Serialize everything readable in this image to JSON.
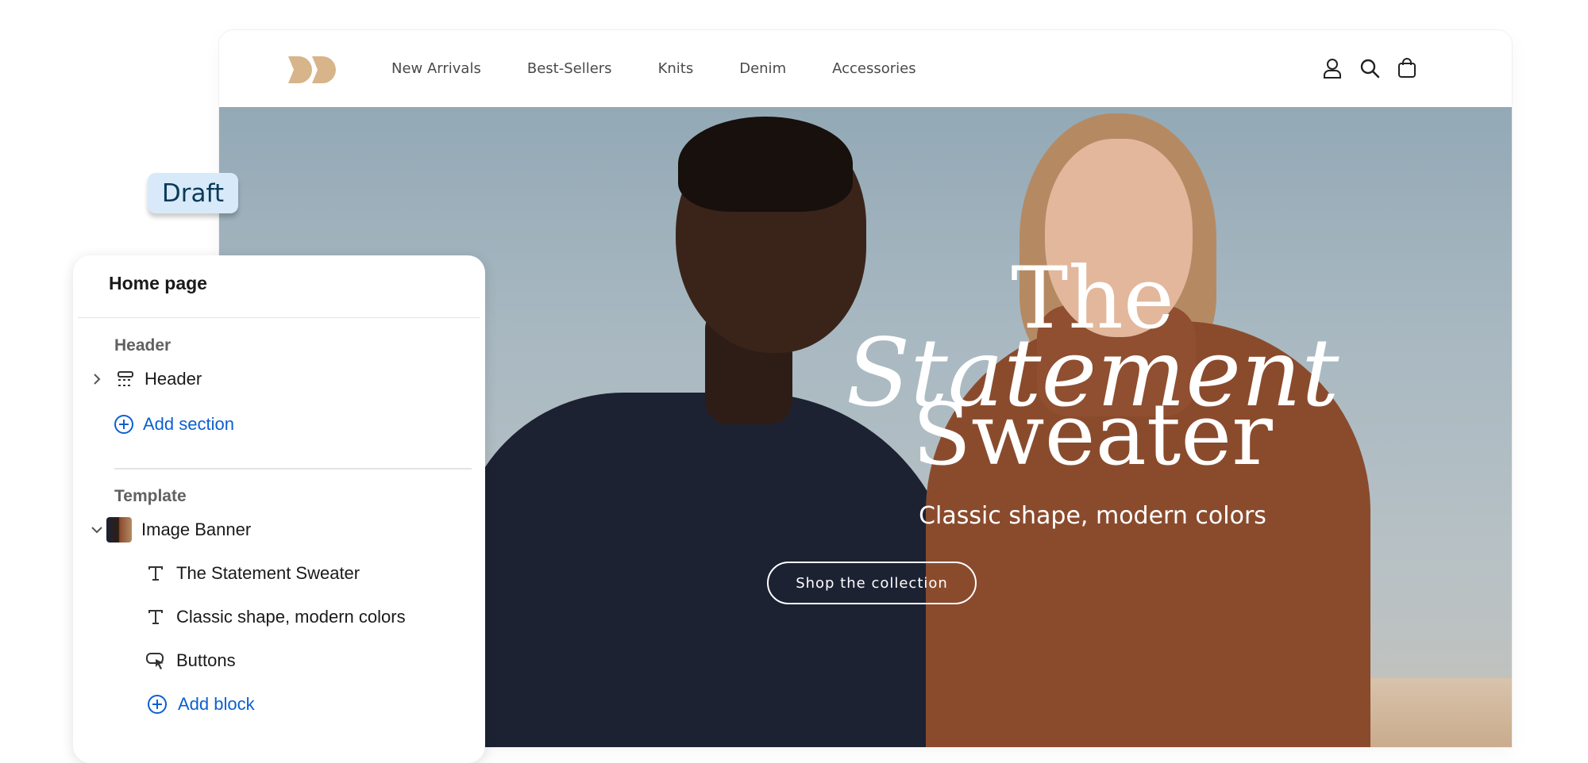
{
  "store": {
    "logo": "DD",
    "nav": [
      "New Arrivals",
      "Best-Sellers",
      "Knits",
      "Denim",
      "Accessories"
    ],
    "icons": [
      "account-icon",
      "search-icon",
      "cart-icon"
    ]
  },
  "hero": {
    "title_line1": "The",
    "title_line2": "Statement",
    "title_line3": "Sweater",
    "subtitle": "Classic shape, modern colors",
    "button": "Shop the collection"
  },
  "badge": {
    "label": "Draft"
  },
  "panel": {
    "title": "Home page",
    "header_group": "Header",
    "header_item": "Header",
    "add_section": "Add section",
    "template_group": "Template",
    "image_banner": "Image Banner",
    "blocks": [
      "The Statement Sweater",
      "Classic shape, modern colors",
      "Buttons"
    ],
    "add_block": "Add block"
  },
  "colors": {
    "accent_blue": "#0b5fd1",
    "badge_bg": "#d8eaf9",
    "badge_text": "#0b3a5b",
    "logo": "#d8b48a"
  }
}
